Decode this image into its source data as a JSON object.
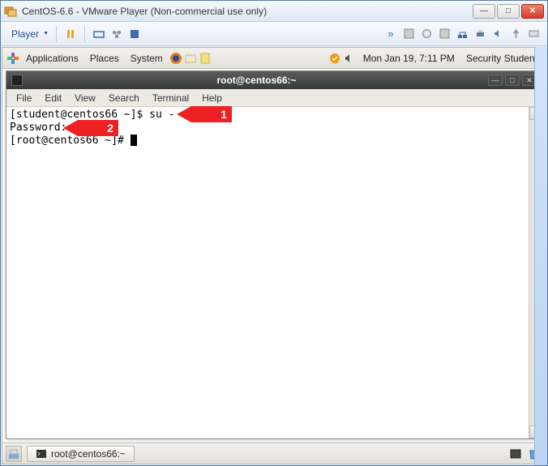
{
  "vmware": {
    "title": "CentOS-6.6 - VMware Player (Non-commercial use only)",
    "player_label": "Player"
  },
  "gnome": {
    "apps": "Applications",
    "places": "Places",
    "system": "System",
    "datetime": "Mon Jan 19,  7:11 PM",
    "user": "Security Student"
  },
  "terminal": {
    "title": "root@centos66:~",
    "menus": [
      "File",
      "Edit",
      "View",
      "Search",
      "Terminal",
      "Help"
    ],
    "line1": "[student@centos66 ~]$ su - root",
    "line2": "Password: ",
    "line3": "[root@centos66 ~]# "
  },
  "taskbar": {
    "item": "root@centos66:~"
  },
  "callouts": {
    "one": "1",
    "two": "2"
  }
}
